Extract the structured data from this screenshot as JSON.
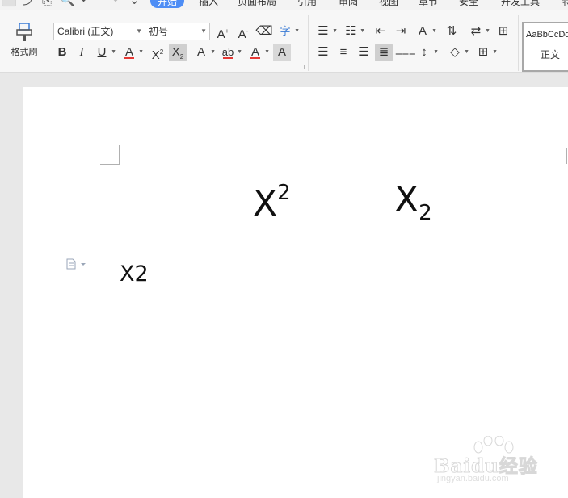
{
  "quick_access": [
    "⬜",
    "⤴",
    "⎘",
    "🔍",
    "↶",
    "↷",
    "⌄"
  ],
  "menu": {
    "tabs": [
      "开始",
      "插入",
      "页面布局",
      "引用",
      "审阅",
      "视图",
      "章节",
      "安全",
      "开发工具",
      "特"
    ],
    "active_tab": "开始"
  },
  "ribbon": {
    "format_painter_label": "格式刷",
    "font_name": "Calibri (正文)",
    "font_size": "初号",
    "style_sample": "AaBbCcDd",
    "style_name": "正文",
    "colors": {
      "highlight": "#e53935",
      "font_color": "#e53935",
      "accent": "#4d8df5"
    }
  },
  "document": {
    "superscript": {
      "base": "X",
      "exp": "2"
    },
    "subscript": {
      "base": "X",
      "sub": "2"
    },
    "plain_text": "X2"
  },
  "watermark": {
    "brand": "Baidu经验",
    "url": "jingyan.baidu.com"
  }
}
